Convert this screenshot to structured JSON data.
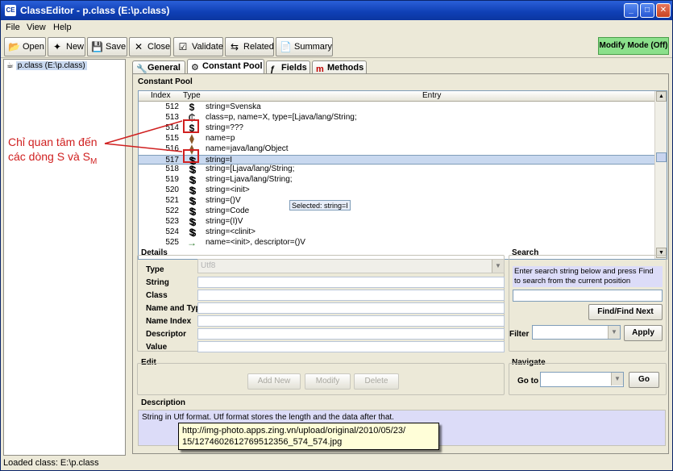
{
  "window": {
    "title": "ClassEditor - p.class (E:\\p.class)",
    "app_icon_text": "CE"
  },
  "menu": [
    "File",
    "View",
    "Help"
  ],
  "toolbar": {
    "open": "Open",
    "new": "New",
    "save": "Save",
    "close": "Close",
    "validate": "Validate",
    "related": "Related",
    "summary": "Summary",
    "mode": "Modify Mode (Off)"
  },
  "tree": {
    "root": "p.class (E:\\p.class)"
  },
  "tabs": [
    "General",
    "Constant Pool",
    "Fields",
    "Methods"
  ],
  "constant_pool": {
    "section_title": "Constant Pool",
    "columns": [
      "Index",
      "Type",
      "Entry"
    ],
    "rows": [
      {
        "index": "512",
        "type": "S",
        "entry": "string=Svenska"
      },
      {
        "index": "513",
        "type": "C",
        "entry": "class=p, name=X, type=[Ljava/lang/String;"
      },
      {
        "index": "514",
        "type": "S",
        "entry": "string=???"
      },
      {
        "index": "515",
        "type": "N",
        "entry": "name=p"
      },
      {
        "index": "516",
        "type": "N",
        "entry": "name=java/lang/Object"
      },
      {
        "index": "517",
        "type": "SM",
        "entry": "string=I"
      },
      {
        "index": "518",
        "type": "SM",
        "entry": "string=[Ljava/lang/String;"
      },
      {
        "index": "519",
        "type": "SM",
        "entry": "string=Ljava/lang/String;"
      },
      {
        "index": "520",
        "type": "SM",
        "entry": "string=<init>"
      },
      {
        "index": "521",
        "type": "SM",
        "entry": "string=()V"
      },
      {
        "index": "522",
        "type": "SM",
        "entry": "string=Code"
      },
      {
        "index": "523",
        "type": "SM",
        "entry": "string=(I)V"
      },
      {
        "index": "524",
        "type": "SM",
        "entry": "string=<clinit>"
      },
      {
        "index": "525",
        "type": "NT",
        "entry": "name=<init>, descriptor=()V"
      }
    ],
    "selected_index": 5,
    "tooltip": "Selected: string=I"
  },
  "details": {
    "section_title": "Details",
    "type_label": "Type",
    "type_value": "Utf8",
    "fields": [
      "String",
      "Class",
      "Name and Type",
      "Name Index",
      "Descriptor",
      "Value"
    ]
  },
  "search": {
    "section_title": "Search",
    "hint": "Enter search string below and press Find to search from the current position",
    "find_button": "Find/Find Next",
    "filter_label": "Filter",
    "apply_button": "Apply"
  },
  "edit": {
    "section_title": "Edit",
    "add_button": "Add New",
    "modify_button": "Modify",
    "delete_button": "Delete"
  },
  "navigate": {
    "section_title": "Navigate",
    "goto_label": "Go to",
    "go_button": "Go"
  },
  "description": {
    "section_title": "Description",
    "text": "String in Utf format. Utf format stores the length and the data after that."
  },
  "status": "Loaded class: E:\\p.class",
  "annotation": {
    "line1": "Chỉ quan tâm đến",
    "line2": "các dòng S và S",
    "line2_sub": "M"
  },
  "url_overlay": {
    "line1": "http://img-photo.apps.zing.vn/upload/original/2010/05/23/",
    "line2": "15/1274602612769512356_574_574.jpg"
  },
  "colors": {
    "title_bar": "#0f3fb4",
    "mode_button": "#8be08b",
    "annotation": "#d02020",
    "selection": "#c8d8ef"
  }
}
